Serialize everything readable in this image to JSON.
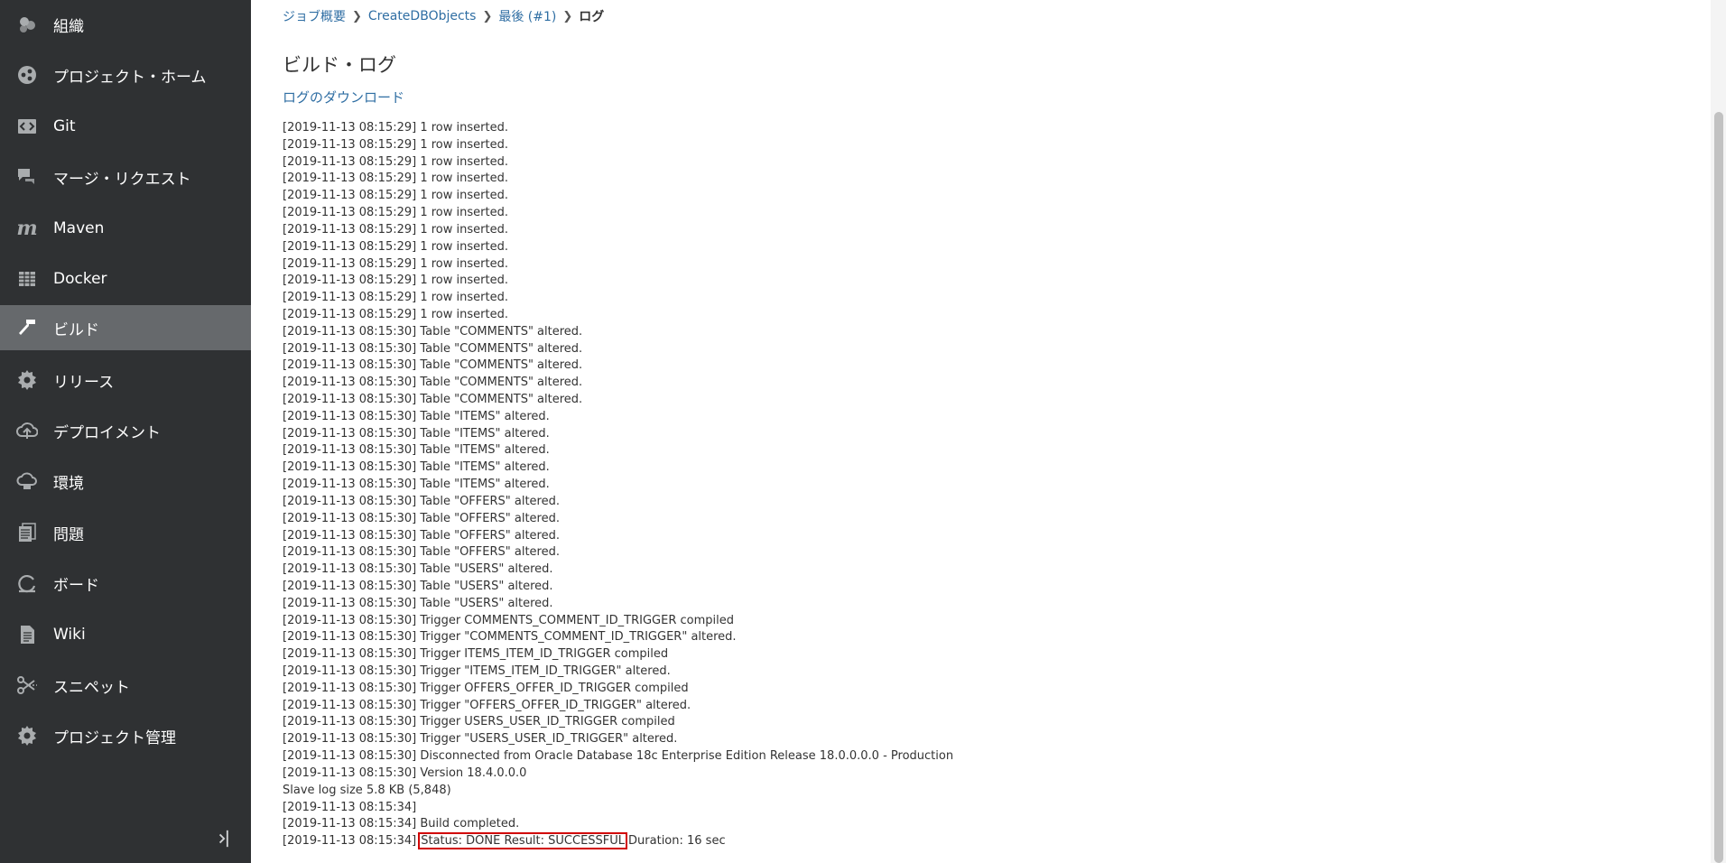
{
  "sidebar": {
    "items": [
      {
        "label": "組織",
        "icon": "organization-icon",
        "active": false
      },
      {
        "label": "プロジェクト・ホーム",
        "icon": "project-home-icon",
        "active": false
      },
      {
        "label": "Git",
        "icon": "git-icon",
        "active": false
      },
      {
        "label": "マージ・リクエスト",
        "icon": "merge-request-icon",
        "active": false
      },
      {
        "label": "Maven",
        "icon": "maven-icon",
        "active": false
      },
      {
        "label": "Docker",
        "icon": "docker-icon",
        "active": false
      },
      {
        "label": "ビルド",
        "icon": "build-hammer-icon",
        "active": true
      },
      {
        "label": "リリース",
        "icon": "release-gear-icon",
        "active": false
      },
      {
        "label": "デプロイメント",
        "icon": "deployment-cloud-icon",
        "active": false
      },
      {
        "label": "環境",
        "icon": "environment-icon",
        "active": false
      },
      {
        "label": "問題",
        "icon": "issues-icon",
        "active": false
      },
      {
        "label": "ボード",
        "icon": "board-icon",
        "active": false
      },
      {
        "label": "Wiki",
        "icon": "wiki-document-icon",
        "active": false
      },
      {
        "label": "スニペット",
        "icon": "snippets-scissors-icon",
        "active": false
      },
      {
        "label": "プロジェクト管理",
        "icon": "project-admin-gear-icon",
        "active": false
      }
    ]
  },
  "breadcrumb": {
    "job_overview": "ジョブ概要",
    "job_name": "CreateDBObjects",
    "latest": "最後 (#1)",
    "current": "ログ"
  },
  "main": {
    "title": "ビルド・ログ",
    "download_link": "ログのダウンロード"
  },
  "log": {
    "lines": [
      "[2019-11-13 08:15:29] 1 row inserted.",
      "[2019-11-13 08:15:29] 1 row inserted.",
      "[2019-11-13 08:15:29] 1 row inserted.",
      "[2019-11-13 08:15:29] 1 row inserted.",
      "[2019-11-13 08:15:29] 1 row inserted.",
      "[2019-11-13 08:15:29] 1 row inserted.",
      "[2019-11-13 08:15:29] 1 row inserted.",
      "[2019-11-13 08:15:29] 1 row inserted.",
      "[2019-11-13 08:15:29] 1 row inserted.",
      "[2019-11-13 08:15:29] 1 row inserted.",
      "[2019-11-13 08:15:29] 1 row inserted.",
      "[2019-11-13 08:15:29] 1 row inserted.",
      "[2019-11-13 08:15:30] Table \"COMMENTS\" altered.",
      "[2019-11-13 08:15:30] Table \"COMMENTS\" altered.",
      "[2019-11-13 08:15:30] Table \"COMMENTS\" altered.",
      "[2019-11-13 08:15:30] Table \"COMMENTS\" altered.",
      "[2019-11-13 08:15:30] Table \"COMMENTS\" altered.",
      "[2019-11-13 08:15:30] Table \"ITEMS\" altered.",
      "[2019-11-13 08:15:30] Table \"ITEMS\" altered.",
      "[2019-11-13 08:15:30] Table \"ITEMS\" altered.",
      "[2019-11-13 08:15:30] Table \"ITEMS\" altered.",
      "[2019-11-13 08:15:30] Table \"ITEMS\" altered.",
      "[2019-11-13 08:15:30] Table \"OFFERS\" altered.",
      "[2019-11-13 08:15:30] Table \"OFFERS\" altered.",
      "[2019-11-13 08:15:30] Table \"OFFERS\" altered.",
      "[2019-11-13 08:15:30] Table \"OFFERS\" altered.",
      "[2019-11-13 08:15:30] Table \"USERS\" altered.",
      "[2019-11-13 08:15:30] Table \"USERS\" altered.",
      "[2019-11-13 08:15:30] Table \"USERS\" altered.",
      "[2019-11-13 08:15:30] Trigger COMMENTS_COMMENT_ID_TRIGGER compiled",
      "[2019-11-13 08:15:30] Trigger \"COMMENTS_COMMENT_ID_TRIGGER\" altered.",
      "[2019-11-13 08:15:30] Trigger ITEMS_ITEM_ID_TRIGGER compiled",
      "[2019-11-13 08:15:30] Trigger \"ITEMS_ITEM_ID_TRIGGER\" altered.",
      "[2019-11-13 08:15:30] Trigger OFFERS_OFFER_ID_TRIGGER compiled",
      "[2019-11-13 08:15:30] Trigger \"OFFERS_OFFER_ID_TRIGGER\" altered.",
      "[2019-11-13 08:15:30] Trigger USERS_USER_ID_TRIGGER compiled",
      "[2019-11-13 08:15:30] Trigger \"USERS_USER_ID_TRIGGER\" altered.",
      "[2019-11-13 08:15:30] Disconnected from Oracle Database 18c Enterprise Edition Release 18.0.0.0.0 - Production",
      "[2019-11-13 08:15:30] Version 18.4.0.0.0",
      "Slave log size 5.8 KB (5,848)",
      "[2019-11-13 08:15:34]",
      "[2019-11-13 08:15:34] Build completed."
    ],
    "final_line": {
      "prefix": "[2019-11-13 08:15:34]",
      "status": "Status: DONE Result: SUCCESSFUL",
      "suffix": "Duration: 16 sec"
    }
  },
  "colors": {
    "sidebar_bg": "#2f3133",
    "sidebar_active_bg": "#66696c",
    "link": "#2f6ea3",
    "highlight_box": "#d10000"
  }
}
